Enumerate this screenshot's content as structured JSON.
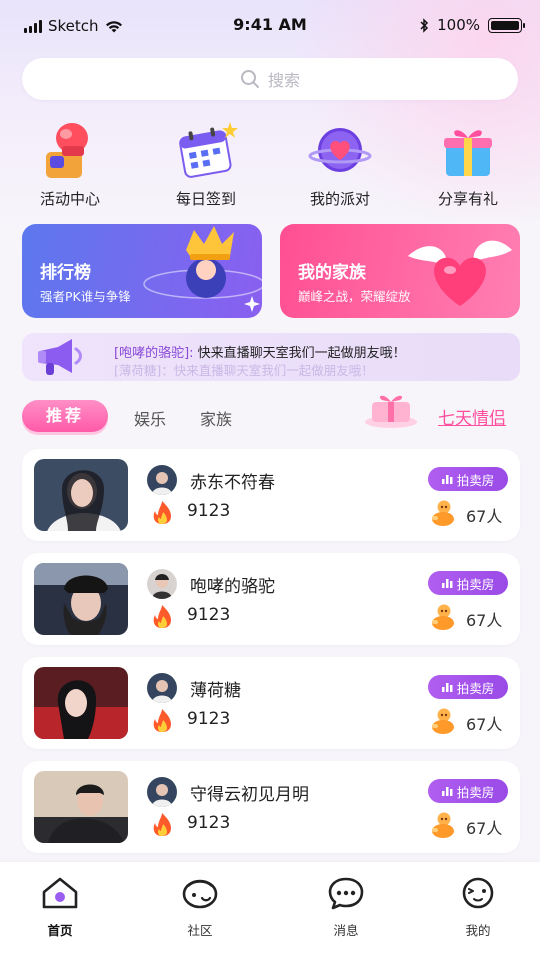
{
  "status_bar": {
    "carrier": "Sketch",
    "time": "9:41 AM",
    "battery": "100%"
  },
  "search": {
    "placeholder": "搜索"
  },
  "quick_entries": [
    {
      "label": "活动中心",
      "icon": "boxing-glove-icon"
    },
    {
      "label": "每日签到",
      "icon": "calendar-icon"
    },
    {
      "label": "我的派对",
      "icon": "party-heart-icon"
    },
    {
      "label": "分享有礼",
      "icon": "gift-box-icon"
    }
  ],
  "banners": {
    "ranking": {
      "title": "排行榜",
      "subtitle": "强者PK谁与争锋",
      "color": "#6a6cf0"
    },
    "family": {
      "title": "我的家族",
      "subtitle": "巅峰之战，荣耀绽放",
      "color": "#ff5a9a"
    }
  },
  "notice": {
    "name": "[咆哮的骆驼]:",
    "message": "快来直播聊天室我们一起做朋友哦！",
    "next_line": "[薄荷糖]：快来直播聊天室我们一起做朋友哦！"
  },
  "tabs": {
    "items": [
      "推荐",
      "娱乐",
      "家族"
    ],
    "active": "推荐",
    "promo": "七天情侣"
  },
  "rooms": [
    {
      "name": "赤东不符春",
      "score": "9123",
      "tag": "拍卖房",
      "people": "67人"
    },
    {
      "name": "咆哮的骆驼",
      "score": "9123",
      "tag": "拍卖房",
      "people": "67人"
    },
    {
      "name": "薄荷糖",
      "score": "9123",
      "tag": "拍卖房",
      "people": "67人"
    },
    {
      "name": "守得云初见月明",
      "score": "9123",
      "tag": "拍卖房",
      "people": "67人"
    }
  ],
  "bottom_nav": [
    {
      "label": "首页",
      "icon": "home-icon",
      "active": true
    },
    {
      "label": "社区",
      "icon": "community-icon",
      "active": false
    },
    {
      "label": "消息",
      "icon": "message-icon",
      "active": false
    },
    {
      "label": "我的",
      "icon": "profile-icon",
      "active": false
    }
  ],
  "colors": {
    "accent_pink": "#ff5aa8",
    "accent_purple": "#9a4ae6",
    "background": "#f7f5fa"
  }
}
